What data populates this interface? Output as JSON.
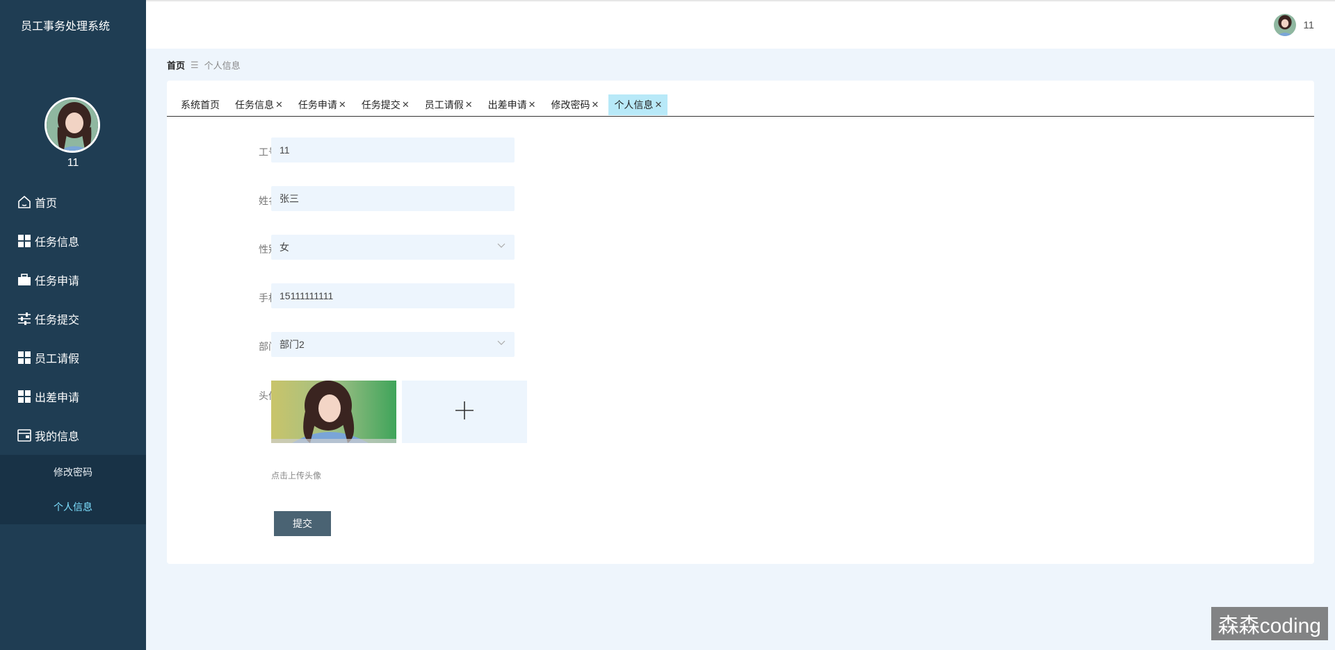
{
  "sidebar": {
    "system_title": "员工事务处理系统",
    "username": "11",
    "menu": [
      {
        "label": "首页",
        "icon": "home-icon"
      },
      {
        "label": "任务信息",
        "icon": "grid-icon"
      },
      {
        "label": "任务申请",
        "icon": "briefcase-icon"
      },
      {
        "label": "任务提交",
        "icon": "sliders-icon"
      },
      {
        "label": "员工请假",
        "icon": "grid-icon"
      },
      {
        "label": "出差申请",
        "icon": "grid-icon"
      },
      {
        "label": "我的信息",
        "icon": "wallet-icon"
      }
    ],
    "submenu": [
      {
        "label": "修改密码"
      },
      {
        "label": "个人信息"
      }
    ]
  },
  "header": {
    "username": "11"
  },
  "breadcrumb": {
    "home": "首页",
    "separator": "☰",
    "current": "个人信息"
  },
  "tabs": [
    {
      "label": "系统首页",
      "closable": false
    },
    {
      "label": "任务信息",
      "closable": true
    },
    {
      "label": "任务申请",
      "closable": true
    },
    {
      "label": "任务提交",
      "closable": true
    },
    {
      "label": "员工请假",
      "closable": true
    },
    {
      "label": "出差申请",
      "closable": true
    },
    {
      "label": "修改密码",
      "closable": true
    },
    {
      "label": "个人信息",
      "closable": true
    }
  ],
  "form": {
    "employee_no": {
      "label": "工号",
      "value": "11"
    },
    "name": {
      "label": "姓名",
      "value": "张三"
    },
    "gender": {
      "label": "性别",
      "value": "女"
    },
    "phone": {
      "label": "手机",
      "value": "15111111111"
    },
    "department": {
      "label": "部门",
      "value": "部门2"
    },
    "avatar": {
      "label": "头像",
      "hint": "点击上传头像"
    },
    "submit_label": "提交"
  },
  "watermark": "森森coding",
  "colors": {
    "sidebar_bg": "#1f3d53",
    "submenu_bg": "#183246",
    "active_tab": "#b8e9f8",
    "field_bg": "#edf5fd",
    "submit_bg": "#4a6373"
  }
}
